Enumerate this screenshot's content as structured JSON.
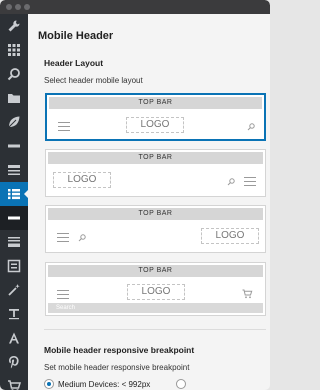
{
  "page": {
    "title": "Mobile Header"
  },
  "layout_section": {
    "title": "Header Layout",
    "description": "Select header mobile layout",
    "options": [
      {
        "topbar_label": "TOP  BAR",
        "logo_label": "LOGO",
        "selected": true
      },
      {
        "topbar_label": "TOP  BAR",
        "logo_label": "LOGO",
        "selected": false
      },
      {
        "topbar_label": "TOP  BAR",
        "logo_label": "LOGO",
        "selected": false
      },
      {
        "topbar_label": "TOP  BAR",
        "logo_label": "LOGO",
        "search_placeholder": "Search",
        "selected": false
      }
    ]
  },
  "breakpoint_section": {
    "title": "Mobile header responsive breakpoint",
    "description": "Set mobile header responsive breakpoint",
    "options": [
      {
        "label": "Medium Devices: < 992px",
        "selected": true
      },
      {
        "label": "",
        "selected": false
      }
    ]
  },
  "sidebar": {
    "icons": [
      "wrench-icon",
      "grid-icon",
      "search-icon",
      "folder-icon",
      "leaf-icon",
      "minus-bar-icon",
      "header-bar-icon",
      "list-icon",
      "minus-bar-icon",
      "footer-icon",
      "widget-icon",
      "magic-wand-icon",
      "text-icon",
      "font-icon",
      "pinterest-icon",
      "cart-icon"
    ],
    "active_index": 7
  },
  "colors": {
    "accent": "#0a73b5",
    "sidebar_bg": "#2c3035",
    "titlebar_bg": "#3b3b3d"
  }
}
